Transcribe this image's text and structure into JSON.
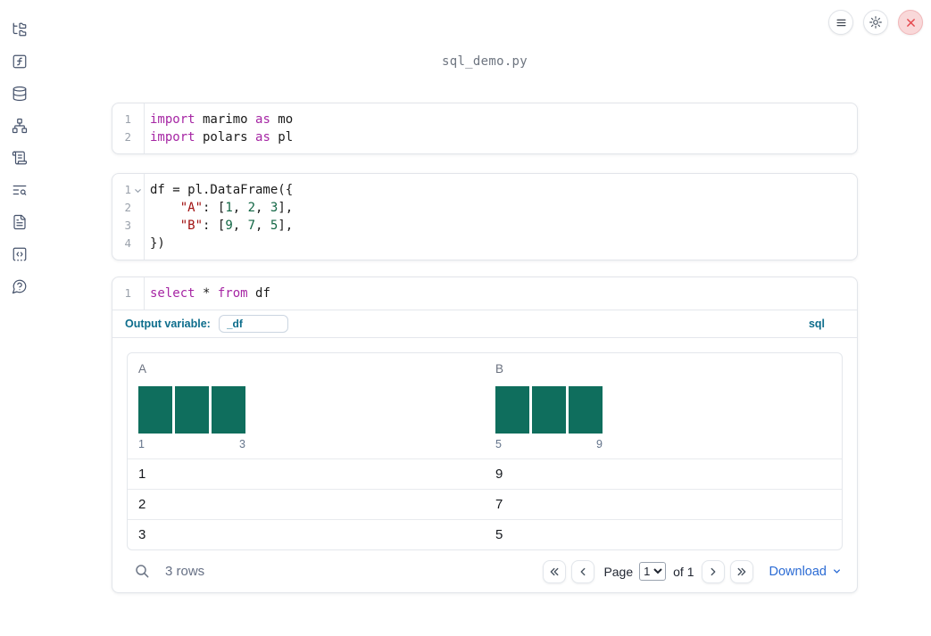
{
  "colors": {
    "histogram_bar": "#0f6e5d",
    "link_blue": "#2b6bd4",
    "sql_accent": "#0d6d8c",
    "keyword": "#a626a4",
    "string": "#a11111",
    "number": "#116644",
    "close_red": "#e5484d"
  },
  "sidebar": {
    "items": [
      {
        "icon": "folder-tree-icon"
      },
      {
        "icon": "function-square-icon"
      },
      {
        "icon": "database-icon"
      },
      {
        "icon": "dependency-graph-icon"
      },
      {
        "icon": "scroll-icon"
      },
      {
        "icon": "list-search-icon"
      },
      {
        "icon": "document-icon"
      },
      {
        "icon": "snippets-icon"
      },
      {
        "icon": "help-chat-icon"
      }
    ]
  },
  "window_controls": {
    "menu_icon": "hamburger-menu-icon",
    "settings_icon": "gear-icon",
    "close_icon": "close-x-icon"
  },
  "notebook": {
    "filename": "sql_demo.py"
  },
  "code": {
    "imports": {
      "lines": [
        {
          "num": "1",
          "segs": [
            {
              "c": "kw",
              "t": "import"
            },
            {
              "c": "pl",
              "t": " marimo "
            },
            {
              "c": "kw",
              "t": "as"
            },
            {
              "c": "pl",
              "t": " mo"
            }
          ]
        },
        {
          "num": "2",
          "segs": [
            {
              "c": "kw",
              "t": "import"
            },
            {
              "c": "pl",
              "t": " polars "
            },
            {
              "c": "kw",
              "t": "as"
            },
            {
              "c": "pl",
              "t": " pl"
            }
          ]
        }
      ]
    },
    "dataframe": {
      "lines": [
        {
          "num": "1",
          "fold": true,
          "segs": [
            {
              "c": "pl",
              "t": "df = pl.DataFrame({"
            }
          ]
        },
        {
          "num": "2",
          "segs": [
            {
              "c": "pl",
              "t": "    "
            },
            {
              "c": "str",
              "t": "\"A\""
            },
            {
              "c": "pl",
              "t": ": ["
            },
            {
              "c": "num",
              "t": "1"
            },
            {
              "c": "pl",
              "t": ", "
            },
            {
              "c": "num",
              "t": "2"
            },
            {
              "c": "pl",
              "t": ", "
            },
            {
              "c": "num",
              "t": "3"
            },
            {
              "c": "pl",
              "t": "],"
            }
          ]
        },
        {
          "num": "3",
          "segs": [
            {
              "c": "pl",
              "t": "    "
            },
            {
              "c": "str",
              "t": "\"B\""
            },
            {
              "c": "pl",
              "t": ": ["
            },
            {
              "c": "num",
              "t": "9"
            },
            {
              "c": "pl",
              "t": ", "
            },
            {
              "c": "num",
              "t": "7"
            },
            {
              "c": "pl",
              "t": ", "
            },
            {
              "c": "num",
              "t": "5"
            },
            {
              "c": "pl",
              "t": "],"
            }
          ]
        },
        {
          "num": "4",
          "segs": [
            {
              "c": "pl",
              "t": "})"
            }
          ]
        }
      ]
    },
    "sql": {
      "lines": [
        {
          "num": "1",
          "segs": [
            {
              "c": "kw",
              "t": "select"
            },
            {
              "c": "pl",
              "t": " * "
            },
            {
              "c": "kw",
              "t": "from"
            },
            {
              "c": "pl",
              "t": " df"
            }
          ]
        },
        {
          "_comment": null
        }
      ],
      "footer": {
        "output_variable_label": "Output variable:",
        "output_variable_value": "_df",
        "language_label": "sql"
      }
    }
  },
  "result_table": {
    "columns": [
      {
        "header": "A",
        "histogram": {
          "values": [
            1,
            1,
            1
          ],
          "min_label": "1",
          "max_label": "3"
        }
      },
      {
        "header": "B",
        "histogram": {
          "values": [
            1,
            1,
            1
          ],
          "min_label": "5",
          "max_label": "9"
        }
      }
    ],
    "rows": [
      [
        "1",
        "9"
      ],
      [
        "2",
        "7"
      ],
      [
        "3",
        "5"
      ]
    ],
    "footer": {
      "row_count": "3 rows",
      "page_label": "Page",
      "page_value": "1",
      "of_label": "of 1",
      "download_label": "Download"
    }
  }
}
